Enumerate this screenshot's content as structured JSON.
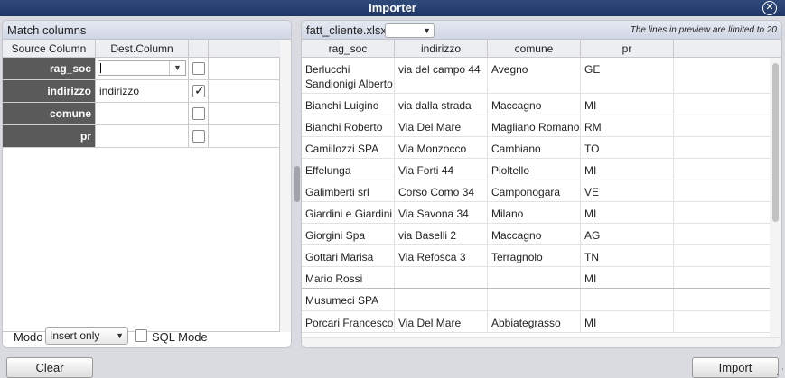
{
  "window": {
    "title": "Importer"
  },
  "match_columns": {
    "title": "Match columns",
    "headers": {
      "source": "Source Column",
      "dest": "Dest.Column"
    },
    "rows": [
      {
        "source": "rag_soc",
        "dest": "",
        "checked": false
      },
      {
        "source": "indirizzo",
        "dest": "indirizzo",
        "checked": true
      },
      {
        "source": "comune",
        "dest": "",
        "checked": false
      },
      {
        "source": "pr",
        "dest": "",
        "checked": false
      }
    ]
  },
  "footer_left": {
    "modo_label": "Modo",
    "modo_value": "Insert only",
    "sql_mode_label": "SQL Mode",
    "sql_mode_checked": false
  },
  "preview": {
    "file_name": "fatt_cliente.xlsx",
    "sheet_value": "",
    "note": "The lines in preview are limited to 20",
    "columns": [
      "rag_soc",
      "indirizzo",
      "comune",
      "pr"
    ],
    "rows": [
      [
        "Berlucchi Sandionigi Alberto",
        "via del campo 44",
        "Avegno",
        "GE"
      ],
      [
        "Bianchi Luigino",
        "via dalla strada",
        "Maccagno",
        "MI"
      ],
      [
        "Bianchi Roberto",
        "Via Del Mare",
        "Magliano Romano",
        "RM"
      ],
      [
        "Camillozzi SPA",
        "Via Monzocco",
        "Cambiano",
        "TO"
      ],
      [
        "Effelunga",
        "Via Forti 44",
        "Pioltello",
        "MI"
      ],
      [
        "Galimberti srl",
        "Corso Como 34",
        "Camponogara",
        "VE"
      ],
      [
        "Giardini e Giardini",
        "Via Savona 34",
        "Milano",
        "MI"
      ],
      [
        "Giorgini Spa",
        "via Baselli 2",
        "Maccagno",
        "AG"
      ],
      [
        "Gottari Marisa",
        "Via Refosca 3",
        "Terragnolo",
        "TN"
      ],
      [
        "Mario Rossi",
        "",
        "",
        "MI"
      ],
      [
        "Musumeci SPA",
        "",
        "",
        ""
      ],
      [
        "Porcari Francesco",
        "Via Del Mare",
        "Abbiategrasso",
        "MI"
      ]
    ]
  },
  "buttons": {
    "clear": "Clear",
    "import": "Import"
  },
  "icons": {
    "close": "close-icon",
    "dropdown": "chevron-down-icon",
    "check": "check-icon"
  }
}
